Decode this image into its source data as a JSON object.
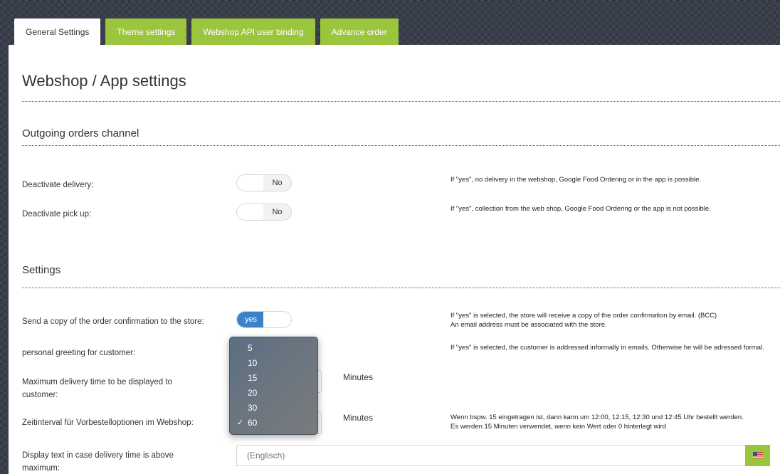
{
  "tabs": [
    {
      "label": "General Settings"
    },
    {
      "label": "Theme settings"
    },
    {
      "label": "Webshop API user binding"
    },
    {
      "label": "Advance order"
    }
  ],
  "page": {
    "title": "Webshop / App settings"
  },
  "outgoing": {
    "title": "Outgoing orders channel",
    "delivery": {
      "label": "Deactivate delivery:",
      "value": "No",
      "help": "If \"yes\", no delivery in the webshop, Google Food Ordering or in the app is possible."
    },
    "pickup": {
      "label": "Deactivate pick up:",
      "value": "No",
      "help": "If \"yes\", collection from the web shop, Google Food Ordering or the app is not possible."
    }
  },
  "settings": {
    "title": "Settings",
    "copy": {
      "label": "Send a copy of the order confirmation to the store:",
      "value": "yes",
      "help1": "If \"yes\" is selected, the store will receive a copy of the order confirmation by email. (BCC)",
      "help2": "An email address must be associated with the store."
    },
    "greeting": {
      "label": "personal greeting for customer:",
      "help": "If \"yes\" is selected, the customer is addressed informally in emails. Otherwise he will be adressed formal."
    },
    "maxdelivery": {
      "label1": "Maximum delivery time to be displayed to",
      "label2": "customer:",
      "unit": "Minutes"
    },
    "interval": {
      "label": "Zeitinterval für Vorbestelloptionen im Webshop:",
      "unit": "Minutes",
      "help1": "Wenn bspw. 15 eingetragen ist, dann kann um 12:00, 12:15, 12:30 und 12:45 Uhr bestellt werden.",
      "help2": "Es werden 15 Minuten verwendet, wenn kein Wert oder 0 hinterlegt wird"
    },
    "displaytext": {
      "label1": "Display text in case delivery time is above",
      "label2": "maximum:",
      "placeholder": "(Englisch)"
    }
  },
  "dropdown": {
    "options": [
      "5",
      "10",
      "15",
      "20",
      "30",
      "60"
    ],
    "selected": "60",
    "check": "✓"
  },
  "colors": {
    "accent": "#9bc53d",
    "toggle_on": "#3c82c9"
  }
}
